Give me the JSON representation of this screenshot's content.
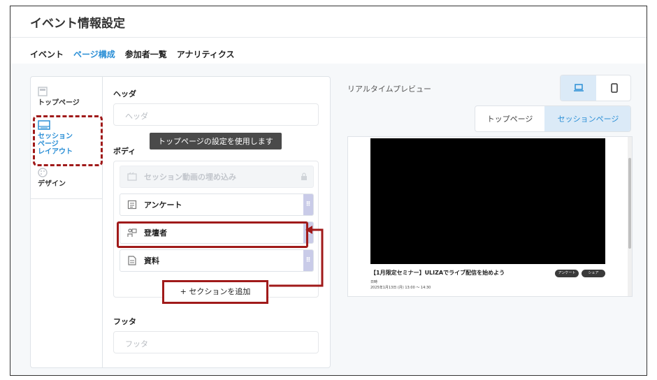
{
  "app": {
    "title": "イベント情報設定"
  },
  "tabs": [
    {
      "label": "イベント",
      "active": false
    },
    {
      "label": "ページ構成",
      "active": true
    },
    {
      "label": "参加者一覧",
      "active": false
    },
    {
      "label": "アナリティクス",
      "active": false
    }
  ],
  "sidebar": {
    "items": [
      {
        "label": "トップページ",
        "icon": "page-icon"
      },
      {
        "label_lines": [
          "セッション",
          "ページ",
          "レイアウト"
        ],
        "icon": "layout-icon",
        "selected": true
      },
      {
        "label": "デザイン",
        "icon": "palette-icon"
      }
    ]
  },
  "editor": {
    "header_label": "ヘッダ",
    "header_placeholder": "ヘッダ",
    "body_label": "ボディ",
    "tooltip": "トップページの設定を使用します",
    "sections": [
      {
        "label": "セッション動画の埋め込み",
        "icon": "video-embed-icon",
        "locked": true
      },
      {
        "label": "アンケート",
        "icon": "survey-icon",
        "locked": false
      },
      {
        "label": "登壇者",
        "icon": "speaker-icon",
        "locked": false
      },
      {
        "label": "資料",
        "icon": "document-icon",
        "locked": false
      }
    ],
    "add_section": "+ セクションを追加",
    "footer_label": "フッタ",
    "footer_placeholder": "フッタ"
  },
  "preview": {
    "label": "リアルタイムプレビュー",
    "device_options": [
      "desktop-icon",
      "mobile-icon"
    ],
    "selected_device": "desktop",
    "page_tabs": [
      "トップページ",
      "セッションページ"
    ],
    "selected_page": "セッションページ",
    "session_title": "【1月限定セミナー】ULIZAでライブ配信を始めよう",
    "date_label": "日時",
    "date_value": "2025年1月13日 (月) 13:00 ～ 14:30",
    "chips": [
      "アンケート",
      "シェア"
    ]
  },
  "colors": {
    "accent": "#2b8fd6",
    "annotation_red": "#a01a1a",
    "selected_bg": "#dbeaf7"
  }
}
